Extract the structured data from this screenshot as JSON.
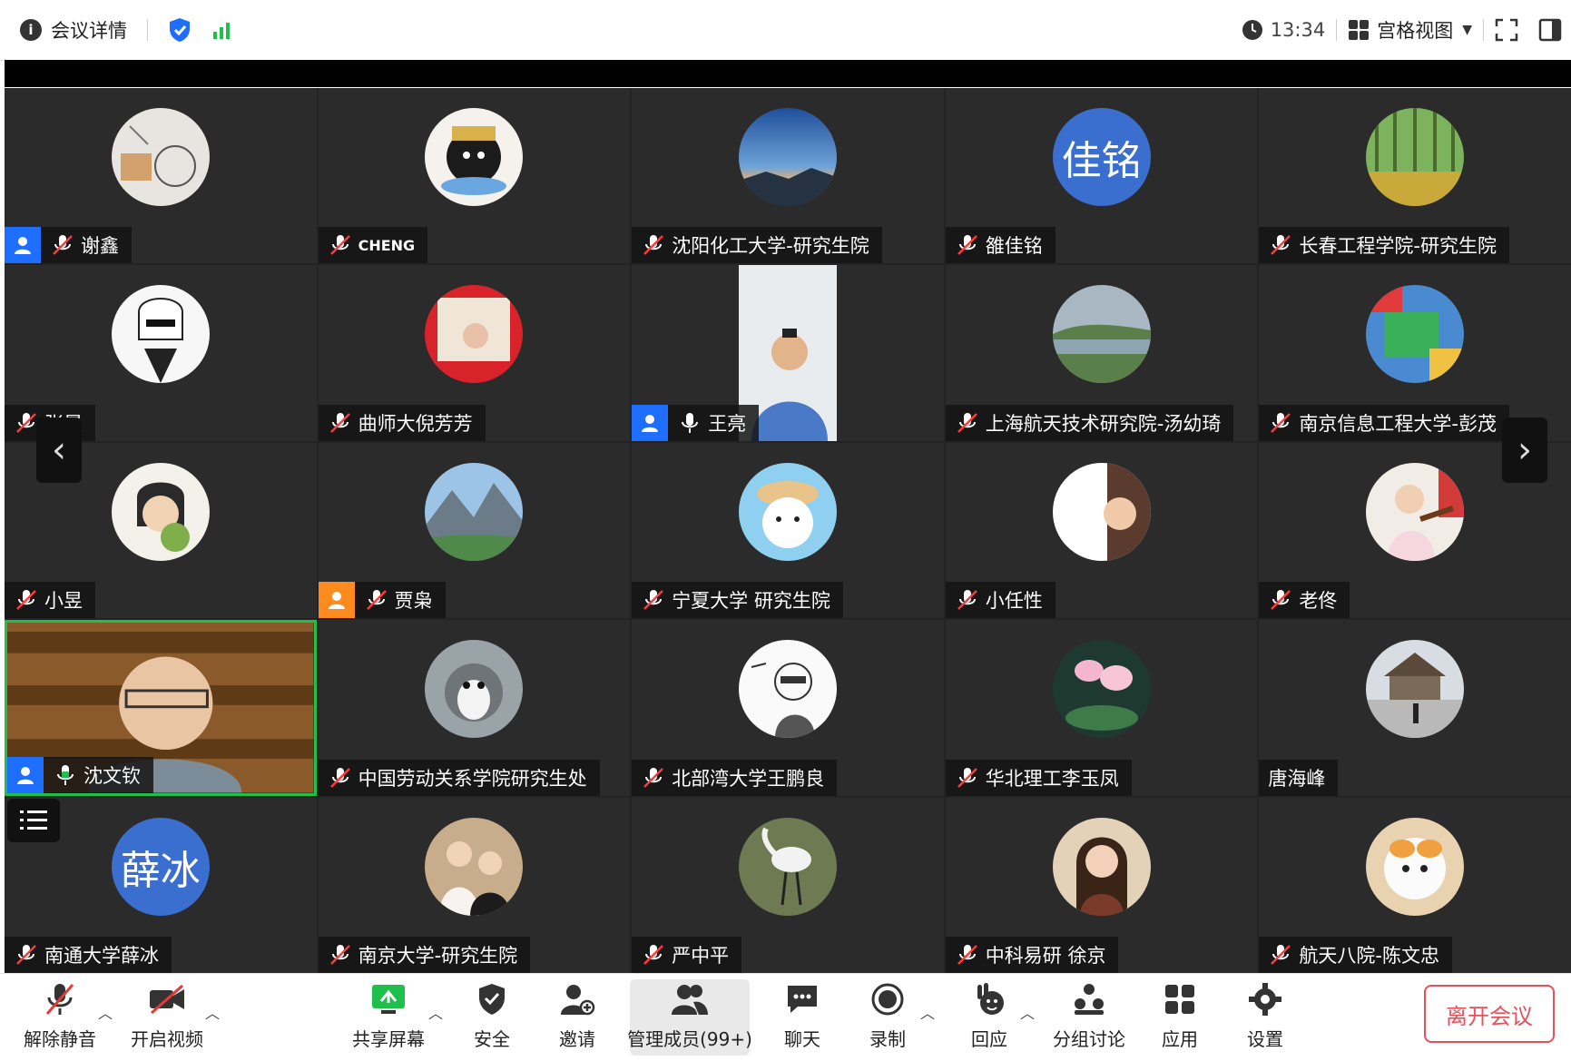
{
  "topbar": {
    "meeting_details": "会议详情",
    "time": "13:34",
    "view_mode": "宫格视图"
  },
  "participants": [
    {
      "name": "谢鑫",
      "avatar": "photo",
      "host": true
    },
    {
      "name": "CHENG",
      "avatar": "photo"
    },
    {
      "name": "沈阳化工大学-研究生院",
      "avatar": "photo"
    },
    {
      "name": "雒佳铭",
      "avatar_text": "佳铭"
    },
    {
      "name": "长春工程学院-研究生院",
      "avatar": "photo"
    },
    {
      "name": "张晨",
      "avatar": "photo"
    },
    {
      "name": "曲师大倪芳芳",
      "avatar": "photo"
    },
    {
      "name": "王亮",
      "avatar": "video",
      "host": true,
      "mic": "on"
    },
    {
      "name": "上海航天技术研究院-汤幼琦",
      "avatar": "photo"
    },
    {
      "name": "南京信息工程大学-彭茂",
      "avatar": "photo"
    },
    {
      "name": "小昱",
      "avatar": "photo"
    },
    {
      "name": "贾枭",
      "avatar": "photo",
      "host": "orange"
    },
    {
      "name": "宁夏大学 研究生院",
      "avatar": "photo"
    },
    {
      "name": "小任性",
      "avatar": "photo"
    },
    {
      "name": "老佟",
      "avatar": "photo"
    },
    {
      "name": "沈文钦",
      "avatar": "video",
      "host": true,
      "mic": "on",
      "speaking": true
    },
    {
      "name": "中国劳动关系学院研究生处",
      "avatar": "photo"
    },
    {
      "name": "北部湾大学王鹏良",
      "avatar": "photo"
    },
    {
      "name": "华北理工李玉凤",
      "avatar": "photo"
    },
    {
      "name": "唐海峰",
      "avatar": "photo",
      "mic": "none"
    },
    {
      "name": "南通大学薛冰",
      "avatar_text": "薛冰"
    },
    {
      "name": "南京大学-研究生院",
      "avatar": "photo"
    },
    {
      "name": "严中平",
      "avatar": "photo"
    },
    {
      "name": "中科易研 徐京",
      "avatar": "photo"
    },
    {
      "name": "航天八院-陈文忠",
      "avatar": "photo"
    }
  ],
  "toolbar": {
    "unmute": "解除静音",
    "start_video": "开启视频",
    "share_screen": "共享屏幕",
    "security": "安全",
    "invite": "邀请",
    "manage_members": "管理成员(99+)",
    "chat": "聊天",
    "record": "录制",
    "react": "回应",
    "breakout": "分组讨论",
    "apps": "应用",
    "settings": "设置",
    "leave": "离开会议"
  },
  "colors": {
    "host_badge": "#1e6fff",
    "speaking_border": "#1fbf4c",
    "leave": "#e8505b"
  }
}
